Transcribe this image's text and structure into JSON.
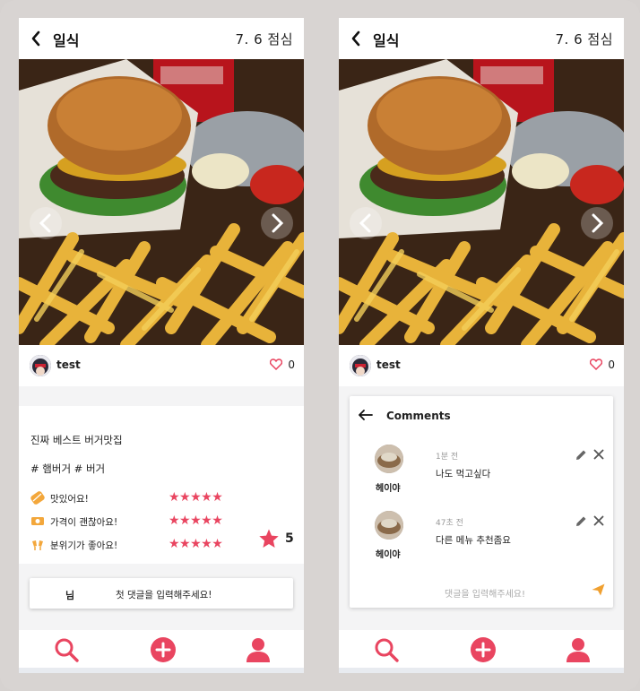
{
  "post": {
    "title": "일식",
    "score": "7. 6 점심",
    "username": "test",
    "likes": "0",
    "description": "진짜 베스트 버거맛집",
    "tags": "# 햄버거  # 버거",
    "ratings": [
      {
        "label": "맛있어요!",
        "icon": "burger-icon",
        "stars": 5
      },
      {
        "label": "가격이 괜찮아요!",
        "icon": "money-icon",
        "stars": 5
      },
      {
        "label": "분위기가 좋아요!",
        "icon": "cheers-icon",
        "stars": 5
      }
    ],
    "overall_rating": "5",
    "star_glyphs": "★★★★★"
  },
  "comment_input": {
    "name": "님",
    "placeholder": "첫 댓글을 입력해주세요!"
  },
  "comments_panel": {
    "title": "Comments",
    "items": [
      {
        "name": "헤이야",
        "time": "1분 전",
        "text": "나도 먹고싶다"
      },
      {
        "name": "헤이야",
        "time": "47초 전",
        "text": "다른 메뉴 추천좀요"
      }
    ],
    "input_placeholder": "댓글을 입력해주세요!"
  },
  "colors": {
    "accent": "#e94560",
    "heart": "#e94560",
    "send": "#f0a030"
  },
  "icons": [
    "back-arrow-icon",
    "chevron-left-icon",
    "chevron-right-icon",
    "heart-icon",
    "star-icon",
    "search-icon",
    "add-circle-icon",
    "user-icon",
    "pencil-icon",
    "close-icon",
    "send-icon"
  ]
}
